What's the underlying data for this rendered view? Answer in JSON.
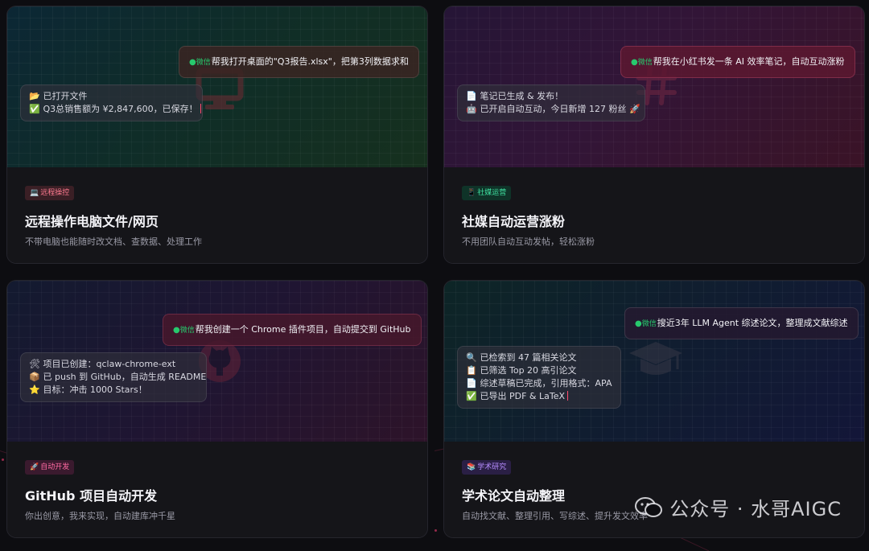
{
  "cards": [
    {
      "tag": {
        "icon": "💻",
        "label": "远程操控"
      },
      "bubble": {
        "app": "微信",
        "text": "帮我打开桌面的\"Q3报告.xlsx\"，把第3列数据求和"
      },
      "status_lines": [
        {
          "icon": "📂",
          "text": "已打开文件"
        },
        {
          "icon": "✅",
          "text": "Q3总销售额为 ¥2,847,600，已保存！"
        }
      ],
      "title": "远程操作电脑文件/网页",
      "desc": "不带电脑也能随时改文档、查数据、处理工作",
      "bg_icon": "monitor-icon"
    },
    {
      "tag": {
        "icon": "📱",
        "label": "社媒运营"
      },
      "bubble": {
        "app": "微信",
        "text": "帮我在小红书发一条 AI 效率笔记，自动互动涨粉"
      },
      "status_lines": [
        {
          "icon": "📄",
          "text": "笔记已生成 & 发布！"
        },
        {
          "icon": "🤖",
          "text": "已开启自动互动，今日新增 127 粉丝 🚀"
        }
      ],
      "title": "社媒自动运营涨粉",
      "desc": "不用团队自动互动发帖，轻松涨粉",
      "bg_icon": "hashtag-icon"
    },
    {
      "tag": {
        "icon": "🚀",
        "label": "自动开发"
      },
      "bubble": {
        "app": "微信",
        "text": "帮我创建一个 Chrome 插件项目，自动提交到 GitHub"
      },
      "status_lines": [
        {
          "icon": "🛠",
          "text": "项目已创建：qclaw-chrome-ext"
        },
        {
          "icon": "📦",
          "text": "已 push 到 GitHub，自动生成 README"
        },
        {
          "icon": "⭐",
          "text": "目标：冲击 1000 Stars！"
        }
      ],
      "title": "GitHub 项目自动开发",
      "desc": "你出创意，我来实现，自动建库冲千星",
      "bg_icon": "github-icon"
    },
    {
      "tag": {
        "icon": "📚",
        "label": "学术研究"
      },
      "bubble": {
        "app": "微信",
        "text": "搜近3年 LLM Agent 综述论文，整理成文献综述"
      },
      "status_lines": [
        {
          "icon": "🔍",
          "text": "已检索到 47 篇相关论文"
        },
        {
          "icon": "📋",
          "text": "已筛选 Top 20 高引论文"
        },
        {
          "icon": "📄",
          "text": "综述草稿已完成，引用格式：APA"
        },
        {
          "icon": "✅",
          "text": "已导出 PDF & LaTeX"
        }
      ],
      "title": "学术论文自动整理",
      "desc": "自动找文献、整理引用、写综述、提升发文效率",
      "bg_icon": "graduation-cap-icon"
    }
  ],
  "watermark": {
    "text": "公众号 · 水哥AIGC",
    "icon": "wechat-icon"
  },
  "colors": {
    "page_bg": "#0d0d11",
    "wechat_green": "#27c96d",
    "cursor_red": "#ff4b6e"
  }
}
